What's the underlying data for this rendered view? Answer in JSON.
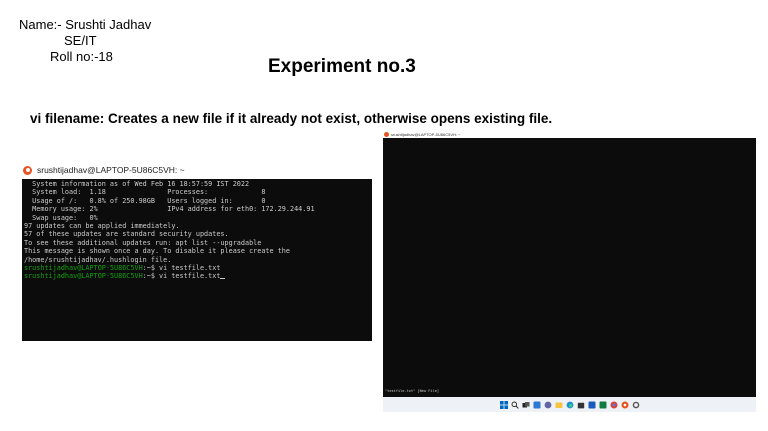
{
  "header": {
    "name": "Name:- Srushti Jadhav",
    "class": "SE/IT",
    "roll": "Roll no:-18",
    "title": "Experiment no.3",
    "description": "vi filename: Creates a new file if it already not exist, otherwise opens existing file."
  },
  "left_terminal": {
    "title": "srushtijadhav@LAPTOP-5U86C5VH: ~",
    "lines": [
      "  System information as of Wed Feb 16 18:57:59 IST 2022",
      "",
      "  System load:  1.18               Processes:             8",
      "  Usage of /:   0.8% of 250.98GB   Users logged in:       0",
      "  Memory usage: 2%                 IPv4 address for eth0: 172.29.244.91",
      "  Swap usage:   0%",
      "",
      "97 updates can be applied immediately.",
      "57 of these updates are standard security updates.",
      "To see these additional updates run: apt list --upgradable",
      "",
      "",
      "",
      "This message is shown once a day. To disable it please create the",
      "/home/srushtijadhav/.hushlogin file."
    ],
    "prompt": "srushtijadhav@LAPTOP-5U86C5VH",
    "prompt_suffix": ":~$ ",
    "commands": [
      "vi testfile.txt",
      "vi testfile.txt"
    ]
  },
  "right_terminal": {
    "title": "srushtijadhav@LAPTOP-5U86C5VH: ~",
    "status_line": "\"testfile.txt\" [New File]"
  },
  "colors": {
    "terminal_bg": "#0c0c0c",
    "terminal_text": "#cccccc",
    "prompt_green": "#13a10e",
    "ubuntu_orange": "#e95420"
  },
  "taskbar_icons": [
    "windows-start-icon",
    "search-icon",
    "task-view-icon",
    "widgets-icon",
    "chat-icon",
    "file-explorer-icon",
    "edge-icon",
    "store-icon",
    "word-icon",
    "excel-icon",
    "chrome-icon",
    "ubuntu-icon",
    "settings-icon"
  ]
}
